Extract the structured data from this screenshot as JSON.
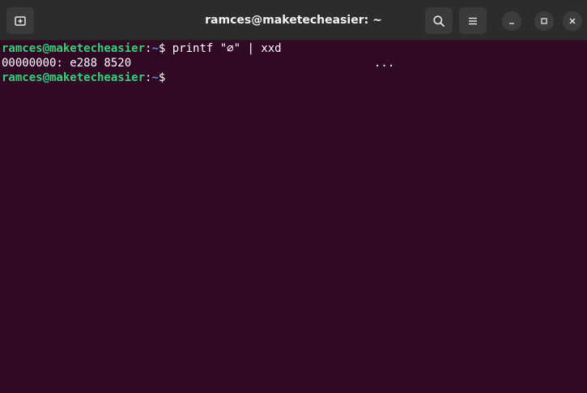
{
  "window": {
    "title": "ramces@maketecheasier: ~"
  },
  "header": {
    "icons": [
      "new-tab-icon",
      "search-icon",
      "hamburger-menu-icon"
    ],
    "window_controls": [
      "minimize-icon",
      "maximize-icon",
      "close-icon"
    ]
  },
  "terminal": {
    "lines": [
      {
        "user_host": "ramces@maketecheasier",
        "colon": ":",
        "path": "~",
        "prompt": "$ ",
        "command": "printf \"∅\" | xxd"
      },
      {
        "output": "00000000: e288 8520",
        "trailing": "..."
      },
      {
        "user_host": "ramces@maketecheasier",
        "colon": ":",
        "path": "~",
        "prompt": "$"
      }
    ]
  },
  "colors": {
    "background": "#300a24",
    "user_host": "#33d17a",
    "path": "#5a8dd8",
    "titlebar": "#2c2c2c"
  }
}
